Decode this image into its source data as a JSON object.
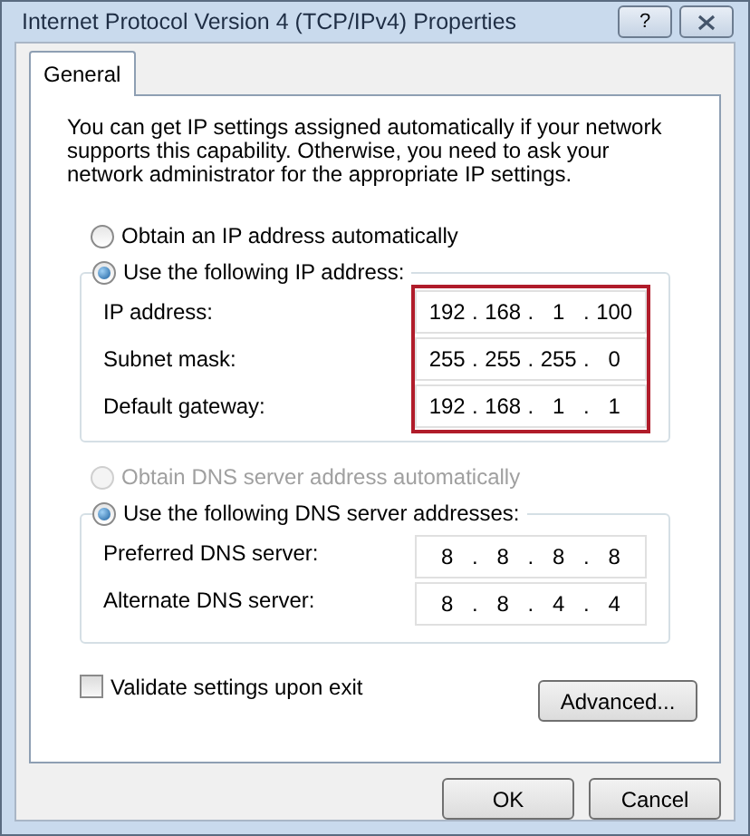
{
  "window": {
    "title": "Internet Protocol Version 4 (TCP/IPv4) Properties",
    "help_button": "?"
  },
  "tabs": [
    {
      "label": "General",
      "selected": true
    }
  ],
  "intro": "You can get IP settings assigned automatically if your network supports this capability. Otherwise, you need to ask your network administrator for the appropriate IP settings.",
  "octet_separator": ".",
  "ip_section": {
    "options": [
      {
        "label": "Obtain an IP address automatically",
        "selected": false,
        "disabled": false
      },
      {
        "label": "Use the following IP address:",
        "selected": true,
        "disabled": false
      }
    ],
    "highlighted": true,
    "fields": [
      {
        "label": "IP address:",
        "octets": [
          "192",
          "168",
          "1",
          "100"
        ]
      },
      {
        "label": "Subnet mask:",
        "octets": [
          "255",
          "255",
          "255",
          "0"
        ]
      },
      {
        "label": "Default gateway:",
        "octets": [
          "192",
          "168",
          "1",
          "1"
        ]
      }
    ]
  },
  "dns_section": {
    "options": [
      {
        "label": "Obtain DNS server address automatically",
        "selected": false,
        "disabled": true
      },
      {
        "label": "Use the following DNS server addresses:",
        "selected": true,
        "disabled": false
      }
    ],
    "highlighted": false,
    "fields": [
      {
        "label": "Preferred DNS server:",
        "octets": [
          "8",
          "8",
          "8",
          "8"
        ]
      },
      {
        "label": "Alternate DNS server:",
        "octets": [
          "8",
          "8",
          "4",
          "4"
        ]
      }
    ]
  },
  "validate": {
    "label": "Validate settings upon exit",
    "checked": false
  },
  "advanced_button": "Advanced...",
  "buttons": [
    "OK",
    "Cancel"
  ]
}
